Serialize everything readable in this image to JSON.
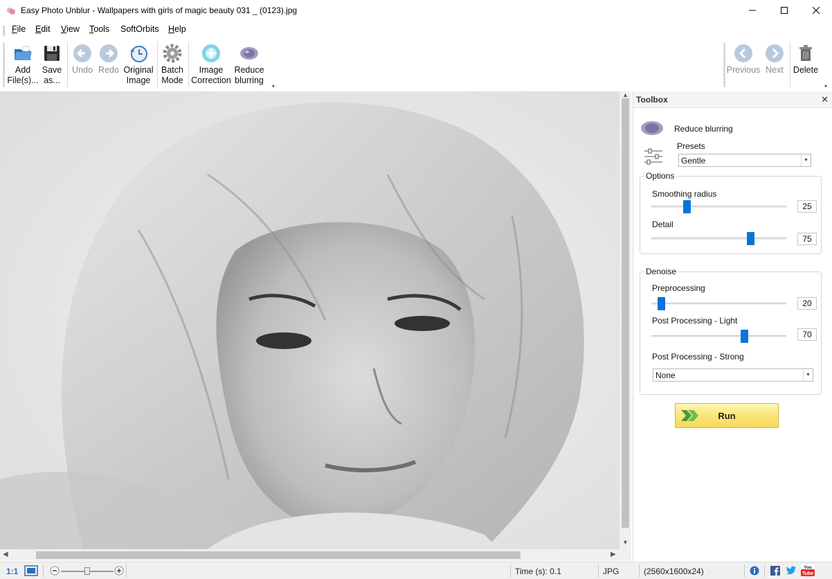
{
  "window": {
    "title": "Easy Photo Unblur - Wallpapers with girls of magic beauty 031 _ (0123).jpg"
  },
  "menu": [
    {
      "pre": "",
      "u": "F",
      "post": "ile"
    },
    {
      "pre": "",
      "u": "E",
      "post": "dit"
    },
    {
      "pre": "",
      "u": "V",
      "post": "iew"
    },
    {
      "pre": "",
      "u": "T",
      "post": "ools"
    },
    {
      "pre": "SoftOrbits",
      "u": "",
      "post": ""
    },
    {
      "pre": "",
      "u": "H",
      "post": "elp"
    }
  ],
  "toolbar": {
    "add_files": {
      "line1": "Add",
      "line2": "File(s)..."
    },
    "save_as": {
      "line1": "Save",
      "line2": "as..."
    },
    "undo": {
      "line1": "Undo"
    },
    "redo": {
      "line1": "Redo"
    },
    "original_image": {
      "line1": "Original",
      "line2": "Image"
    },
    "batch_mode": {
      "line1": "Batch",
      "line2": "Mode"
    },
    "image_correction": {
      "line1": "Image",
      "line2": "Correction"
    },
    "reduce_blurring": {
      "line1": "Reduce",
      "line2": "blurring"
    },
    "previous": {
      "line1": "Previous"
    },
    "next": {
      "line1": "Next"
    },
    "delete": {
      "line1": "Delete"
    }
  },
  "toolbox": {
    "title": "Toolbox",
    "tool_name": "Reduce blurring",
    "presets_label": "Presets",
    "preset_value": "Gentle",
    "options": {
      "title": "Options",
      "smoothing_radius": {
        "label": "Smoothing radius",
        "value": "25",
        "fraction": 0.25
      },
      "detail": {
        "label": "Detail",
        "value": "75",
        "fraction": 0.75
      }
    },
    "denoise": {
      "title": "Denoise",
      "preprocessing": {
        "label": "Preprocessing",
        "value": "20",
        "fraction": 0.05
      },
      "post_light": {
        "label": "Post Processing - Light",
        "value": "70",
        "fraction": 0.7
      },
      "post_strong": {
        "label": "Post Processing - Strong",
        "value": "None"
      }
    },
    "run_label": "Run"
  },
  "statusbar": {
    "zoom_label": "1:1",
    "zoom_fraction": 0.5,
    "time": "Time (s): 0.1",
    "format": "JPG",
    "dimensions": "(2560x1600x24)"
  },
  "colors": {
    "accent": "#0a74da",
    "run_button": "#fbe57a"
  }
}
